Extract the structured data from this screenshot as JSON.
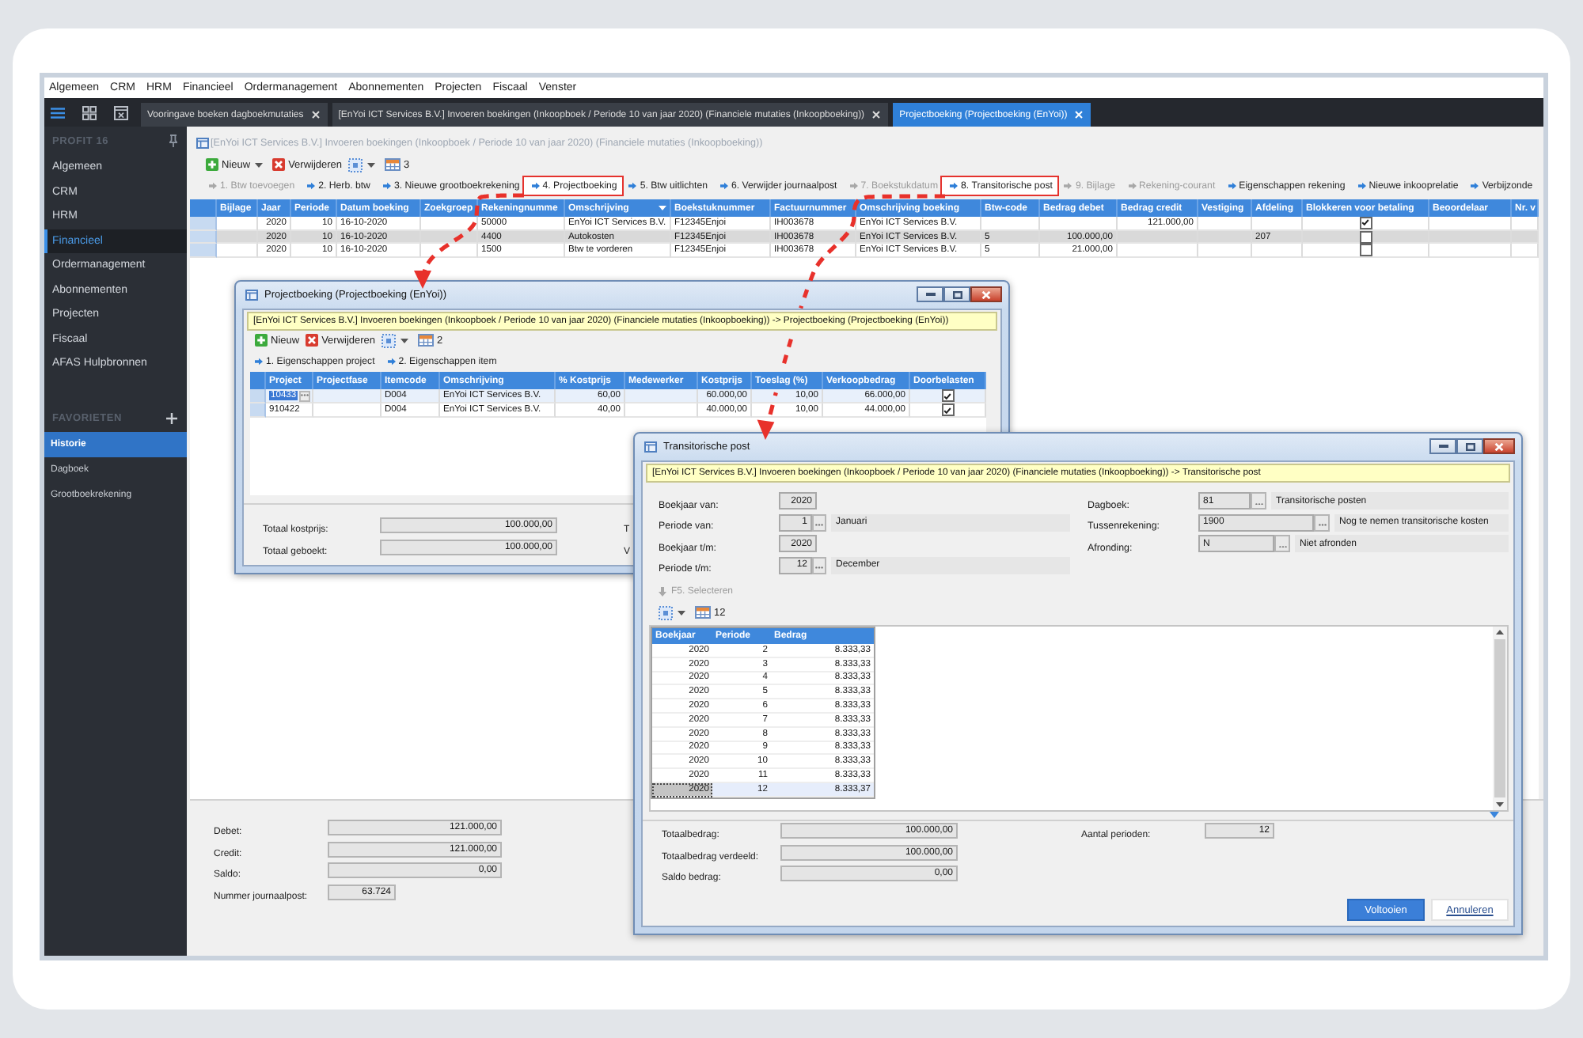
{
  "menu_bar": {
    "items": [
      "Algemeen",
      "CRM",
      "HRM",
      "Financieel",
      "Ordermanagement",
      "Abonnementen",
      "Projecten",
      "Fiscaal",
      "Venster"
    ]
  },
  "tabs": [
    {
      "label": "Vooringave boeken dagboekmutaties",
      "selected": false
    },
    {
      "label": "[EnYoi ICT Services B.V.] Invoeren boekingen (Inkoopboek / Periode 10 van jaar 2020) (Financiele mutaties (Inkoopboeking))",
      "selected": false
    },
    {
      "label": "Projectboeking (Projectboeking (EnYoi))",
      "selected": true
    }
  ],
  "sidebar": {
    "sections": [
      {
        "kind": "modules",
        "title": "PROFIT 16",
        "items": [
          {
            "label": "Algemeen",
            "selected": false
          },
          {
            "label": "CRM",
            "selected": false
          },
          {
            "label": "HRM",
            "selected": false
          },
          {
            "label": "Financieel",
            "selected": true
          },
          {
            "label": "Ordermanagement",
            "selected": false
          },
          {
            "label": "Abonnementen",
            "selected": false
          },
          {
            "label": "Projecten",
            "selected": false
          },
          {
            "label": "Fiscaal",
            "selected": false
          },
          {
            "label": "AFAS Hulpbronnen",
            "selected": false
          }
        ]
      },
      {
        "kind": "favorites",
        "title": "FAVORIETEN",
        "items": [
          {
            "label": "Historie",
            "selected": true
          },
          {
            "label": "Dagboek",
            "selected": false
          },
          {
            "label": "Grootboekrekening",
            "selected": false
          }
        ]
      }
    ]
  },
  "main_window": {
    "title": "[EnYoi ICT Services B.V.] Invoeren boekingen (Inkoopboek / Periode 10 van jaar 2020) (Financiele mutaties (Inkoopboeking))",
    "toolbar": {
      "items": [
        {
          "kind": "new",
          "label": "Nieuw",
          "dropdown": true
        },
        {
          "kind": "delete",
          "label": "Verwijderen",
          "dropdown": false
        },
        {
          "kind": "select",
          "dropdown": true
        },
        {
          "kind": "columns",
          "label": "3",
          "dropdown": false
        }
      ]
    },
    "actions": [
      {
        "label": "1. Btw toevoegen",
        "disabled": true,
        "highlighted": false
      },
      {
        "label": "2. Herb. btw",
        "disabled": false,
        "highlighted": false
      },
      {
        "label": "3. Nieuwe grootboekrekening",
        "disabled": false,
        "highlighted": false
      },
      {
        "label": "4. Projectboeking",
        "disabled": false,
        "highlighted": true
      },
      {
        "label": "5. Btw uitlichten",
        "disabled": false,
        "highlighted": false
      },
      {
        "label": "6. Verwijder journaalpost",
        "disabled": false,
        "highlighted": false
      },
      {
        "label": "7. Boekstukdatum",
        "disabled": true,
        "highlighted": false
      },
      {
        "label": "8. Transitorische post",
        "disabled": false,
        "highlighted": true
      },
      {
        "label": "9. Bijlage",
        "disabled": true,
        "highlighted": false
      },
      {
        "label": "Rekening-courant",
        "disabled": true,
        "highlighted": false
      },
      {
        "label": "Eigenschappen rekening",
        "disabled": false,
        "highlighted": false
      },
      {
        "label": "Nieuwe inkooprelatie",
        "disabled": false,
        "highlighted": false
      },
      {
        "label": "Verbijzonde",
        "disabled": false,
        "highlighted": false
      }
    ],
    "table": {
      "columns": [
        {
          "label": "Bijlage",
          "kind": "text",
          "filter": false
        },
        {
          "label": "Jaar",
          "kind": "number",
          "filter": false
        },
        {
          "label": "Periode",
          "kind": "number",
          "filter": false
        },
        {
          "label": "Datum boeking",
          "kind": "text",
          "filter": false
        },
        {
          "label": "Zoekgroep",
          "kind": "text",
          "filter": false
        },
        {
          "label": "Rekeningnumme",
          "kind": "text",
          "filter": false
        },
        {
          "label": "Omschrijving",
          "kind": "text",
          "filter": true
        },
        {
          "label": "Boekstuknummer",
          "kind": "text",
          "filter": false
        },
        {
          "label": "Factuurnummer",
          "kind": "text",
          "filter": false
        },
        {
          "label": "Omschrijving boeking",
          "kind": "text",
          "filter": false
        },
        {
          "label": "Btw-code",
          "kind": "text",
          "filter": false
        },
        {
          "label": "Bedrag debet",
          "kind": "number",
          "filter": false
        },
        {
          "label": "Bedrag credit",
          "kind": "number",
          "filter": false
        },
        {
          "label": "Vestiging",
          "kind": "text",
          "filter": false
        },
        {
          "label": "Afdeling",
          "kind": "text",
          "filter": false
        },
        {
          "label": "Blokkeren voor betaling",
          "kind": "check",
          "filter": false
        },
        {
          "label": "Beoordelaar",
          "kind": "text",
          "filter": false
        },
        {
          "label": "Nr. v",
          "kind": "text",
          "filter": false
        }
      ],
      "rows": [
        {
          "selected": false,
          "cells": [
            null,
            "2020",
            "10",
            "16-10-2020",
            null,
            "50000",
            "EnYoi ICT Services B.V.",
            "F12345Enjoi",
            "IH003678",
            "EnYoi ICT Services B.V.",
            null,
            null,
            "121.000,00",
            null,
            null,
            {
              "checked": true
            },
            null,
            null
          ]
        },
        {
          "selected": true,
          "cells": [
            null,
            "2020",
            "10",
            "16-10-2020",
            null,
            "4400",
            "Autokosten",
            "F12345Enjoi",
            "IH003678",
            "EnYoi ICT Services B.V.",
            "5",
            "100.000,00",
            null,
            null,
            "207",
            {
              "checked": false
            },
            null,
            null
          ]
        },
        {
          "selected": false,
          "cells": [
            null,
            "2020",
            "10",
            "16-10-2020",
            null,
            "1500",
            "Btw te vorderen",
            "F12345Enjoi",
            "IH003678",
            "EnYoi ICT Services B.V.",
            "5",
            "21.000,00",
            null,
            null,
            null,
            {
              "checked": false
            },
            null,
            null
          ]
        }
      ]
    },
    "totals": [
      {
        "label": "Debet:",
        "value": "121.000,00"
      },
      {
        "label": "Credit:",
        "value": "121.000,00"
      },
      {
        "label": "Saldo:",
        "value": "0,00"
      },
      {
        "label": "Nummer journaalpost:",
        "value": "63.724"
      }
    ]
  },
  "projectboeking_window": {
    "title": "Projectboeking (Projectboeking (EnYoi))",
    "breadcrumb": "[EnYoi ICT Services B.V.] Invoeren boekingen (Inkoopboek / Periode 10 van jaar 2020) (Financiele mutaties (Inkoopboeking)) -> Projectboeking (Projectboeking (EnYoi))",
    "toolbar": {
      "items": [
        {
          "kind": "new",
          "label": "Nieuw",
          "dropdown": false
        },
        {
          "kind": "delete",
          "label": "Verwijderen",
          "dropdown": false
        },
        {
          "kind": "select",
          "dropdown": true
        },
        {
          "kind": "columns",
          "label": "2",
          "dropdown": false
        }
      ]
    },
    "actions": [
      {
        "label": "1. Eigenschappen project",
        "disabled": false,
        "highlighted": false
      },
      {
        "label": "2. Eigenschappen item",
        "disabled": false,
        "highlighted": false
      }
    ],
    "table": {
      "columns": [
        {
          "label": "Project",
          "kind": "text"
        },
        {
          "label": "Projectfase",
          "kind": "text"
        },
        {
          "label": "Itemcode",
          "kind": "text"
        },
        {
          "label": "Omschrijving",
          "kind": "text"
        },
        {
          "label": "% Kostprijs",
          "kind": "number"
        },
        {
          "label": "Medewerker",
          "kind": "text"
        },
        {
          "label": "Kostprijs",
          "kind": "number"
        },
        {
          "label": "Toeslag (%)",
          "kind": "number"
        },
        {
          "label": "Verkoopbedrag",
          "kind": "number"
        },
        {
          "label": "Doorbelasten",
          "kind": "check"
        }
      ],
      "rows": [
        {
          "selected": true,
          "editing": true,
          "cells": [
            "10433",
            null,
            "D004",
            "EnYoi ICT Services B.V.",
            "60,00",
            null,
            "60.000,00",
            "10,00",
            "66.000,00",
            {
              "checked": true
            }
          ]
        },
        {
          "selected": false,
          "editing": false,
          "cells": [
            "910422",
            null,
            "D004",
            "EnYoi ICT Services B.V.",
            "40,00",
            null,
            "40.000,00",
            "10,00",
            "44.000,00",
            {
              "checked": true
            }
          ]
        }
      ]
    },
    "totals": [
      {
        "label": "Totaal kostprijs:",
        "value": "100.000,00"
      },
      {
        "label": "Totaal geboekt:",
        "value": "100.000,00"
      }
    ],
    "totals_right": [
      {
        "label": "T"
      },
      {
        "label": "V"
      }
    ]
  },
  "transitorische_post_window": {
    "title": "Transitorische post",
    "breadcrumb": "[EnYoi ICT Services B.V.] Invoeren boekingen (Inkoopboek / Periode 10 van jaar 2020) (Financiele mutaties (Inkoopboeking)) -> Transitorische post",
    "fields_left": [
      {
        "kind": "plain",
        "label": "Boekjaar van:",
        "value": "2020"
      },
      {
        "kind": "lookup",
        "label": "Periode van:",
        "value": "1",
        "description": "Januari"
      },
      {
        "kind": "plain",
        "label": "Boekjaar t/m:",
        "value": "2020"
      },
      {
        "kind": "lookup",
        "label": "Periode t/m:",
        "value": "12",
        "description": "December"
      }
    ],
    "fields_right": [
      {
        "kind": "lookup",
        "label": "Dagboek:",
        "value": "81",
        "description": "Transitorische posten"
      },
      {
        "kind": "lookup",
        "label": "Tussenrekening:",
        "value": "1900",
        "description": "Nog te nemen transitorische kosten"
      },
      {
        "kind": "lookup",
        "label": "Afronding:",
        "value": "N",
        "description": "Niet afronden"
      }
    ],
    "select_action": {
      "label": "F5. Selecteren",
      "disabled": true
    },
    "toolbar": {
      "items": [
        {
          "kind": "select",
          "dropdown": true
        },
        {
          "kind": "columns",
          "label": "12",
          "dropdown": false
        }
      ]
    },
    "table": {
      "columns": [
        {
          "label": "Boekjaar",
          "kind": "number"
        },
        {
          "label": "Periode",
          "kind": "number"
        },
        {
          "label": "Bedrag",
          "kind": "number"
        }
      ],
      "rows": [
        {
          "selected": false,
          "cells": [
            "2020",
            "2",
            "8.333,33"
          ]
        },
        {
          "selected": false,
          "cells": [
            "2020",
            "3",
            "8.333,33"
          ]
        },
        {
          "selected": false,
          "cells": [
            "2020",
            "4",
            "8.333,33"
          ]
        },
        {
          "selected": false,
          "cells": [
            "2020",
            "5",
            "8.333,33"
          ]
        },
        {
          "selected": false,
          "cells": [
            "2020",
            "6",
            "8.333,33"
          ]
        },
        {
          "selected": false,
          "cells": [
            "2020",
            "7",
            "8.333,33"
          ]
        },
        {
          "selected": false,
          "cells": [
            "2020",
            "8",
            "8.333,33"
          ]
        },
        {
          "selected": false,
          "cells": [
            "2020",
            "9",
            "8.333,33"
          ]
        },
        {
          "selected": false,
          "cells": [
            "2020",
            "10",
            "8.333,33"
          ]
        },
        {
          "selected": false,
          "cells": [
            "2020",
            "11",
            "8.333,33"
          ]
        },
        {
          "selected": true,
          "cells": [
            "2020",
            "12",
            "8.333,37"
          ]
        }
      ]
    },
    "totals_left": [
      {
        "label": "Totaalbedrag:",
        "value": "100.000,00"
      },
      {
        "label": "Totaalbedrag verdeeld:",
        "value": "100.000,00"
      },
      {
        "label": "Saldo bedrag:",
        "value": "0,00"
      }
    ],
    "totals_right": [
      {
        "label": "Aantal perioden:",
        "value": "12"
      }
    ],
    "buttons": [
      {
        "kind": "primary",
        "label": "Voltooien"
      },
      {
        "kind": "secondary",
        "label": "Annuleren"
      }
    ]
  }
}
